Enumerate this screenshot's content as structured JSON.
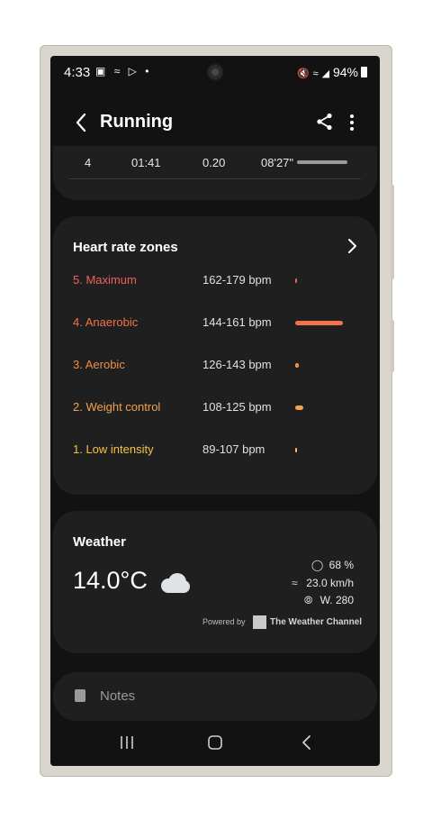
{
  "status_bar": {
    "time": "4:33",
    "left_icons": [
      "image-icon",
      "wind-icon",
      "play-store-icon",
      "dot-icon"
    ],
    "battery": "94%",
    "right_icons": [
      "mute-icon",
      "wifi-icon",
      "signal-icon",
      "battery-icon"
    ]
  },
  "header": {
    "title": "Running"
  },
  "laps": {
    "lap": "4",
    "time": "01:41",
    "distance": "0.20",
    "pace": "08'27\"",
    "bar_fill": 1.0
  },
  "heart_rate": {
    "title": "Heart rate zones",
    "zones": [
      {
        "name": "5. Maximum",
        "range": "162-179 bpm",
        "color": "#f0605a",
        "fraction": 0.03
      },
      {
        "name": "4. Anaerobic",
        "range": "144-161 bpm",
        "color": "#f2734a",
        "fraction": 1.0
      },
      {
        "name": "3. Aerobic",
        "range": "126-143 bpm",
        "color": "#f28c4a",
        "fraction": 0.07
      },
      {
        "name": "2. Weight control",
        "range": "108-125 bpm",
        "color": "#f5a24a",
        "fraction": 0.17
      },
      {
        "name": "1. Low intensity",
        "range": "89-107 bpm",
        "color": "#f7c145",
        "fraction": 0.03
      }
    ]
  },
  "weather": {
    "title": "Weather",
    "temperature": "14.0°C",
    "humidity": "68 %",
    "wind_speed": "23.0 km/h",
    "wind_direction": "W. 280",
    "powered_by": "Powered by",
    "provider": "The Weather Channel",
    "logo_text": "The Weather Channel"
  },
  "notes": {
    "label": "Notes"
  },
  "nav": {
    "items": [
      "recents-icon",
      "home-icon",
      "back-icon"
    ]
  }
}
